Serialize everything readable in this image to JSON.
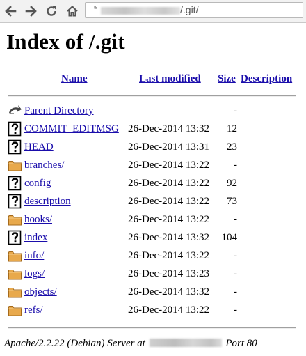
{
  "browser": {
    "url_path": "/.git/"
  },
  "page": {
    "title": "Index of /.git"
  },
  "table": {
    "headers": {
      "name": "Name",
      "modified": "Last modified",
      "size": "Size",
      "description": "Description"
    },
    "rows": [
      {
        "icon": "back-icon",
        "name": "Parent Directory",
        "modified": "",
        "size": "-"
      },
      {
        "icon": "file-icon",
        "name": "COMMIT_EDITMSG",
        "modified": "26-Dec-2014 13:32",
        "size": "12"
      },
      {
        "icon": "file-icon",
        "name": "HEAD",
        "modified": "26-Dec-2014 13:31",
        "size": "23"
      },
      {
        "icon": "folder-icon",
        "name": "branches/",
        "modified": "26-Dec-2014 13:22",
        "size": "-"
      },
      {
        "icon": "file-icon",
        "name": "config",
        "modified": "26-Dec-2014 13:22",
        "size": "92"
      },
      {
        "icon": "file-icon",
        "name": "description",
        "modified": "26-Dec-2014 13:22",
        "size": "73"
      },
      {
        "icon": "folder-icon",
        "name": "hooks/",
        "modified": "26-Dec-2014 13:22",
        "size": "-"
      },
      {
        "icon": "file-icon",
        "name": "index",
        "modified": "26-Dec-2014 13:32",
        "size": "104"
      },
      {
        "icon": "folder-icon",
        "name": "info/",
        "modified": "26-Dec-2014 13:22",
        "size": "-"
      },
      {
        "icon": "folder-icon",
        "name": "logs/",
        "modified": "26-Dec-2014 13:23",
        "size": "-"
      },
      {
        "icon": "folder-icon",
        "name": "objects/",
        "modified": "26-Dec-2014 13:32",
        "size": "-"
      },
      {
        "icon": "folder-icon",
        "name": "refs/",
        "modified": "26-Dec-2014 13:22",
        "size": "-"
      }
    ]
  },
  "footer": {
    "prefix": "Apache/2.2.22 (Debian) Server at",
    "suffix": "Port 80"
  },
  "colors": {
    "link": "#1a0dab",
    "folder": "#e0a040",
    "chrome": "#f2f2f2"
  }
}
